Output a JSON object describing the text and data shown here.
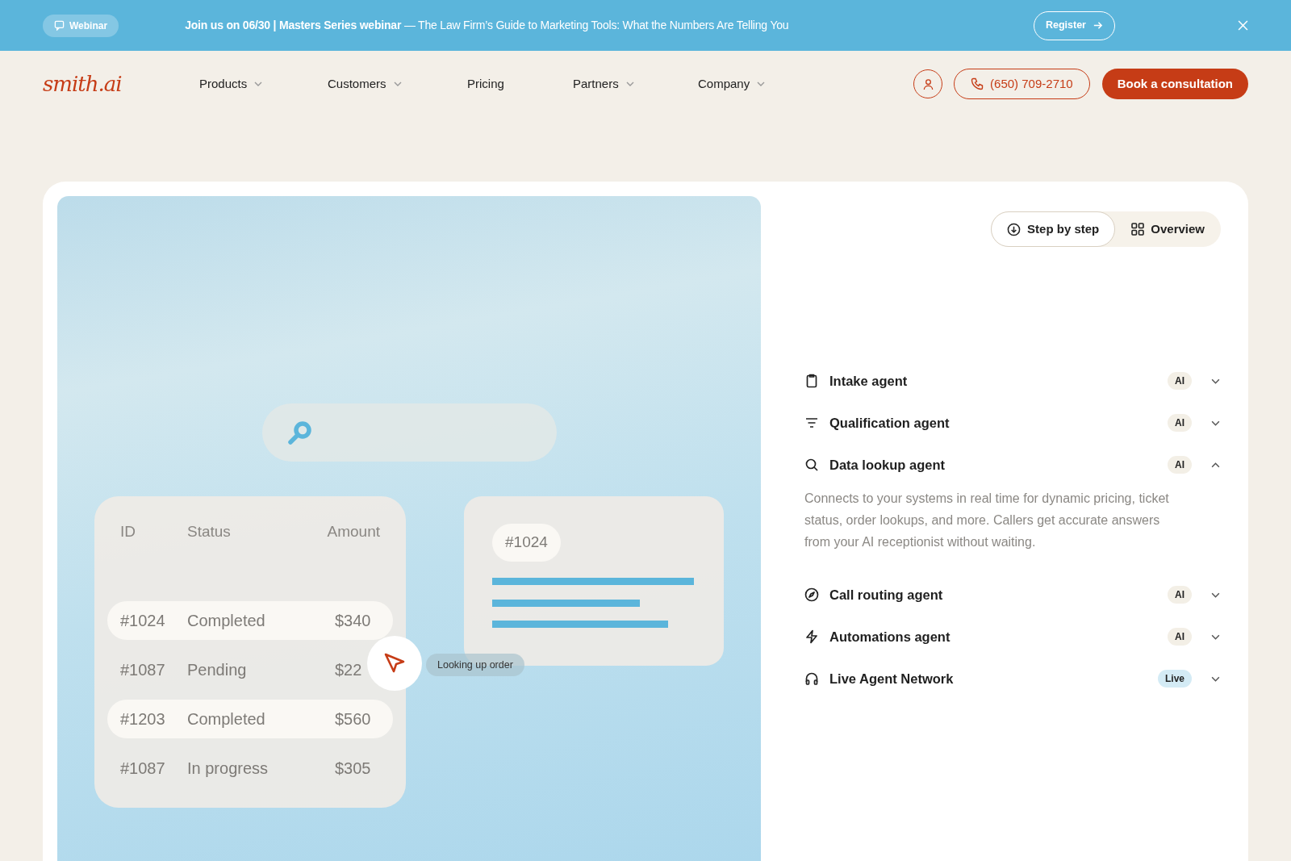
{
  "banner": {
    "tag": "Webinar",
    "message": "**Join us on 06/30 | Masters Series webinar** — The Law Firm’s Guide to Marketing Tools: What the Numbers Are Telling You",
    "button": "Register"
  },
  "nav": {
    "logo": "smith.ai",
    "items": [
      {
        "label": "Products",
        "dropdown": true
      },
      {
        "label": "Customers",
        "dropdown": true
      },
      {
        "label": "Pricing",
        "dropdown": false
      },
      {
        "label": "Partners",
        "dropdown": true
      },
      {
        "label": "Company",
        "dropdown": true
      }
    ],
    "phone": "(650) 709-2710",
    "cta": "Book a consultation"
  },
  "illustration": {
    "table": {
      "columns": [
        "ID",
        "Status",
        "Amount"
      ],
      "rows": [
        {
          "cells": [
            "#1024",
            "Completed",
            "$340"
          ],
          "selected": true
        },
        {
          "cells": [
            "#1087",
            "Pending",
            "$22"
          ],
          "selected": false
        },
        {
          "cells": [
            "#1203",
            "Completed",
            "$560"
          ],
          "selected": true
        },
        {
          "cells": [
            "#1087",
            "In progress",
            "$305"
          ],
          "selected": false
        }
      ]
    },
    "detail_tag": "#1024",
    "cursor_label": "Looking up order"
  },
  "view_toggle": [
    {
      "label": "Step by step",
      "selected": true
    },
    {
      "label": "Overview",
      "selected": false
    }
  ],
  "agents": [
    {
      "title": "Intake agent",
      "badge": "AI",
      "kind": "ai",
      "expanded": false
    },
    {
      "title": "Qualification agent",
      "badge": "AI",
      "kind": "ai",
      "expanded": false
    },
    {
      "title": "Data lookup agent",
      "badge": "AI",
      "kind": "ai",
      "expanded": true,
      "description": "Connects to your systems in real time for dynamic pricing, ticket status, order lookups, and more. Callers get accurate answers from your AI receptionist without waiting."
    },
    {
      "title": "Call routing agent",
      "badge": "AI",
      "kind": "ai",
      "expanded": false
    },
    {
      "title": "Automations agent",
      "badge": "AI",
      "kind": "ai",
      "expanded": false
    },
    {
      "title": "Live Agent Network",
      "badge": "Live",
      "kind": "live",
      "expanded": false
    }
  ]
}
